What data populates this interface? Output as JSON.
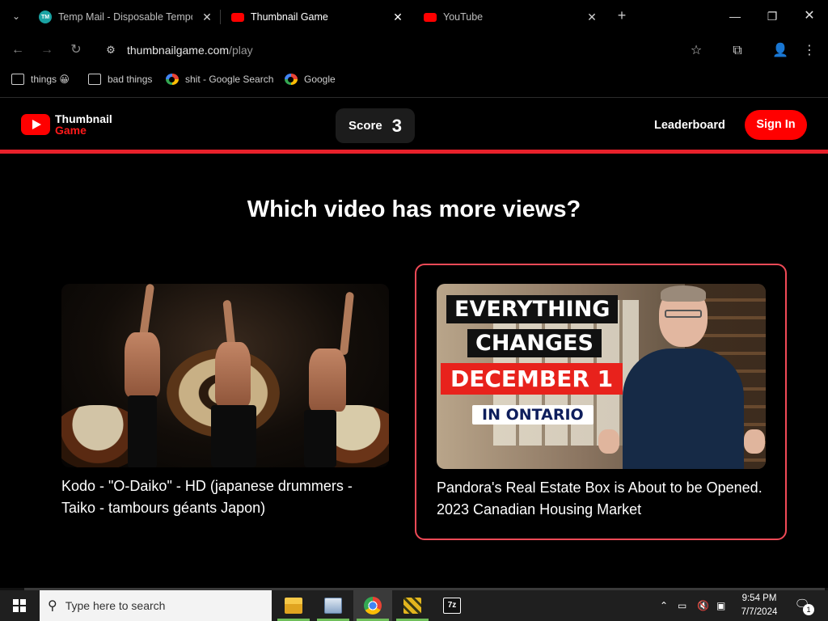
{
  "browser": {
    "tabs": [
      {
        "title": "Temp Mail - Disposable Tempo",
        "favicon_color": "#1aa3a3",
        "active": false
      },
      {
        "title": "Thumbnail Game",
        "favicon_color": "#ff0000",
        "active": true
      },
      {
        "title": "YouTube",
        "favicon_color": "#ff0000",
        "active": false
      }
    ],
    "url_host": "thumbnailgame.com",
    "url_path": "/play",
    "bookmarks": [
      {
        "label": "things 😀",
        "type": "folder"
      },
      {
        "label": "bad things",
        "type": "folder"
      },
      {
        "label": "shit - Google Search",
        "type": "google"
      },
      {
        "label": "Google",
        "type": "google"
      }
    ]
  },
  "site": {
    "logo_line1": "Thumbnail",
    "logo_line2": "Game",
    "score_label": "Score",
    "score_value": "3",
    "leaderboard_label": "Leaderboard",
    "signin_label": "Sign In",
    "accent_color": "#e8212b"
  },
  "main": {
    "question": "Which video has more views?",
    "videos": [
      {
        "title": "Kodo - \"O-Daiko\" - HD (japanese drummers - Taiko - tambours géants Japon)",
        "selected": false
      },
      {
        "title": "Pandora's Real Estate Box is About to be Opened. 2023 Canadian Housing Market",
        "selected": true,
        "overlay": [
          "EVERYTHING",
          "CHANGES",
          "DECEMBER 1",
          "IN ONTARIO"
        ]
      }
    ]
  },
  "taskbar": {
    "search_placeholder": "Type here to search",
    "time": "9:54 PM",
    "date": "7/7/2024",
    "notification_count": "1",
    "apps": [
      "file-explorer",
      "network-app",
      "chrome",
      "puzzle-app",
      "7zip"
    ]
  }
}
